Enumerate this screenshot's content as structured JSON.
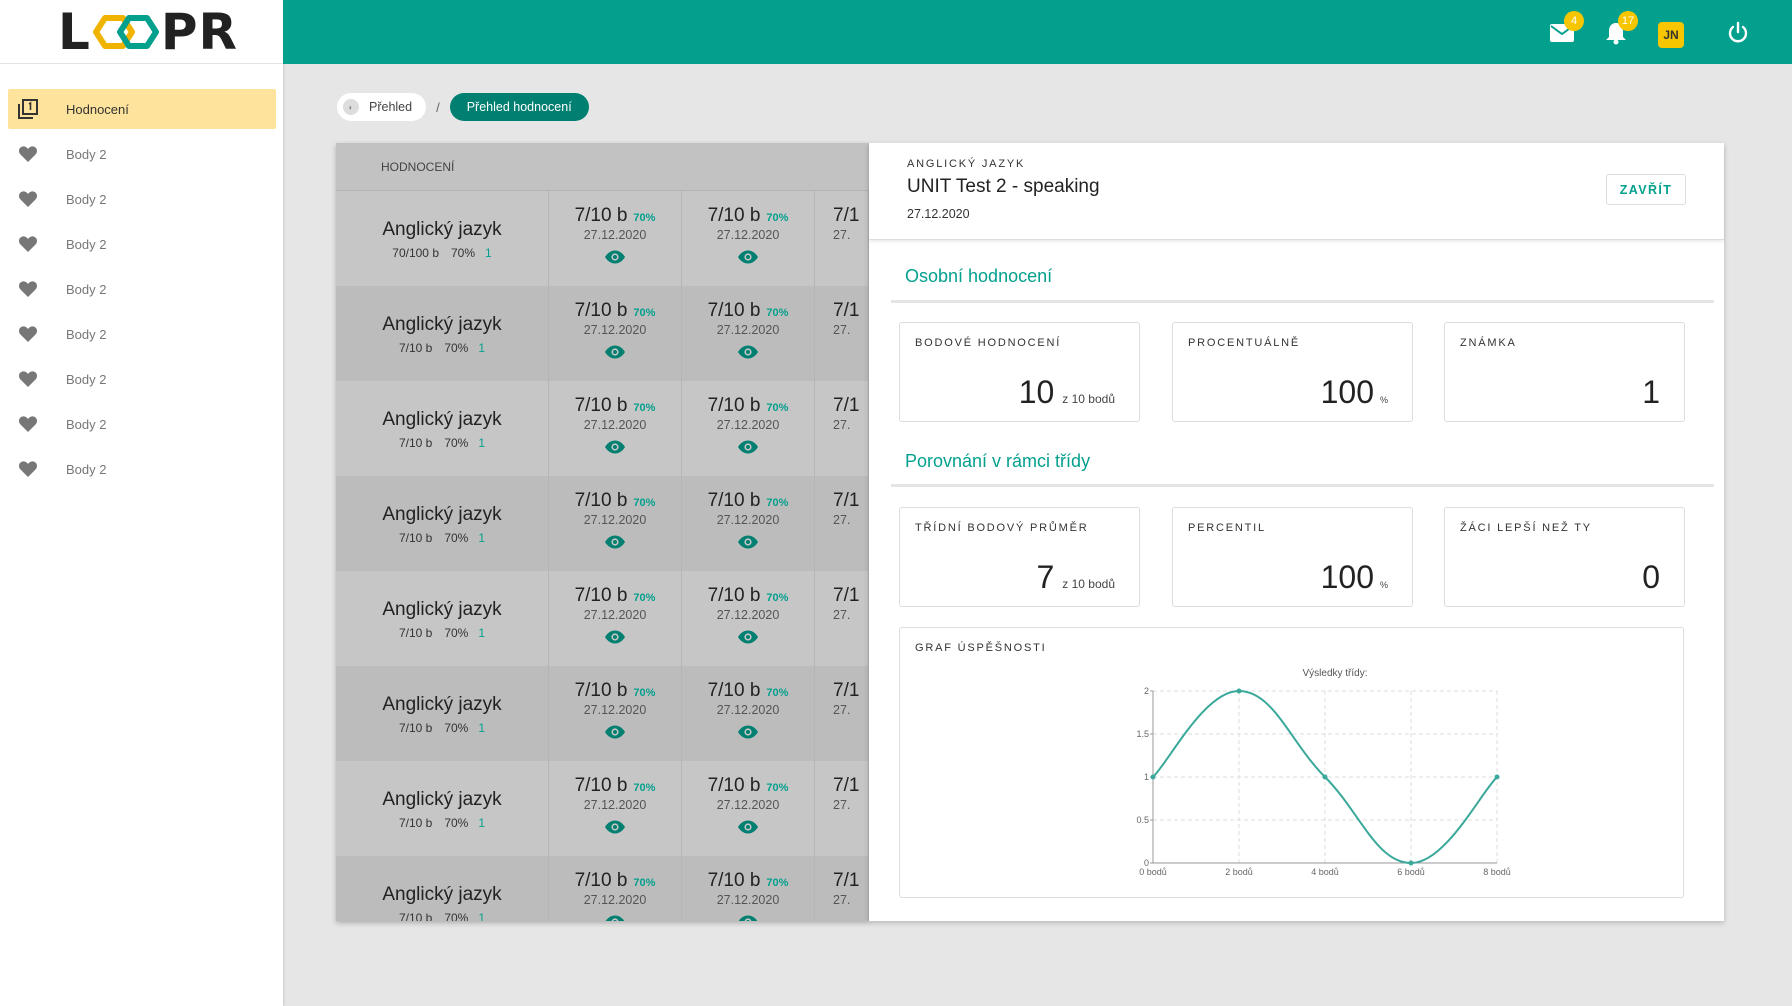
{
  "app": {
    "logo_left": "L",
    "logo_right": "PR"
  },
  "sidebar": {
    "items": [
      {
        "label": "Hodnocení",
        "icon": "library-icon",
        "active": true
      },
      {
        "label": "Body 2",
        "icon": "heart-icon"
      },
      {
        "label": "Body 2",
        "icon": "heart-icon"
      },
      {
        "label": "Body 2",
        "icon": "heart-icon"
      },
      {
        "label": "Body 2",
        "icon": "heart-icon"
      },
      {
        "label": "Body 2",
        "icon": "heart-icon"
      },
      {
        "label": "Body 2",
        "icon": "heart-icon"
      },
      {
        "label": "Body 2",
        "icon": "heart-icon"
      },
      {
        "label": "Body 2",
        "icon": "heart-icon"
      }
    ]
  },
  "topbar": {
    "mail_badge": "4",
    "notif_badge": "17",
    "avatar": "JN",
    "accent": "#04a08e",
    "badge_color": "#f7c600"
  },
  "breadcrumb": {
    "home": "Přehled",
    "separator": "/",
    "current": "Přehled hodnocení"
  },
  "grid": {
    "header": "HODNOCENÍ",
    "rows": [
      {
        "subject": "Anglický jazyk",
        "points": "70/100 b",
        "pct": "70%",
        "grade": "1",
        "cells": [
          {
            "value": "7/10 b",
            "pct": "70%",
            "date": "27.12.2020"
          },
          {
            "value": "7/10 b",
            "pct": "70%",
            "date": "27.12.2020"
          },
          {
            "value": "7/1",
            "pct": "",
            "date": "27."
          }
        ]
      },
      {
        "subject": "Anglický jazyk",
        "points": "7/10 b",
        "pct": "70%",
        "grade": "1",
        "cells": [
          {
            "value": "7/10 b",
            "pct": "70%",
            "date": "27.12.2020"
          },
          {
            "value": "7/10 b",
            "pct": "70%",
            "date": "27.12.2020"
          },
          {
            "value": "7/1",
            "pct": "",
            "date": "27."
          }
        ]
      },
      {
        "subject": "Anglický jazyk",
        "points": "7/10 b",
        "pct": "70%",
        "grade": "1",
        "cells": [
          {
            "value": "7/10 b",
            "pct": "70%",
            "date": "27.12.2020"
          },
          {
            "value": "7/10 b",
            "pct": "70%",
            "date": "27.12.2020"
          },
          {
            "value": "7/1",
            "pct": "",
            "date": "27."
          }
        ]
      },
      {
        "subject": "Anglický jazyk",
        "points": "7/10 b",
        "pct": "70%",
        "grade": "1",
        "cells": [
          {
            "value": "7/10 b",
            "pct": "70%",
            "date": "27.12.2020"
          },
          {
            "value": "7/10 b",
            "pct": "70%",
            "date": "27.12.2020"
          },
          {
            "value": "7/1",
            "pct": "",
            "date": "27."
          }
        ]
      },
      {
        "subject": "Anglický jazyk",
        "points": "7/10 b",
        "pct": "70%",
        "grade": "1",
        "cells": [
          {
            "value": "7/10 b",
            "pct": "70%",
            "date": "27.12.2020"
          },
          {
            "value": "7/10 b",
            "pct": "70%",
            "date": "27.12.2020"
          },
          {
            "value": "7/1",
            "pct": "",
            "date": "27."
          }
        ]
      },
      {
        "subject": "Anglický jazyk",
        "points": "7/10 b",
        "pct": "70%",
        "grade": "1",
        "cells": [
          {
            "value": "7/10 b",
            "pct": "70%",
            "date": "27.12.2020"
          },
          {
            "value": "7/10 b",
            "pct": "70%",
            "date": "27.12.2020"
          },
          {
            "value": "7/1",
            "pct": "",
            "date": "27."
          }
        ]
      },
      {
        "subject": "Anglický jazyk",
        "points": "7/10 b",
        "pct": "70%",
        "grade": "1",
        "cells": [
          {
            "value": "7/10 b",
            "pct": "70%",
            "date": "27.12.2020"
          },
          {
            "value": "7/10 b",
            "pct": "70%",
            "date": "27.12.2020"
          },
          {
            "value": "7/1",
            "pct": "",
            "date": "27."
          }
        ]
      },
      {
        "subject": "Anglický jazyk",
        "points": "7/10 b",
        "pct": "70%",
        "grade": "1",
        "cells": [
          {
            "value": "7/10 b",
            "pct": "70%",
            "date": "27.12.2020"
          },
          {
            "value": "7/10 b",
            "pct": "70%",
            "date": "27.12.2020"
          },
          {
            "value": "7/1",
            "pct": "",
            "date": "27."
          }
        ]
      }
    ]
  },
  "detail": {
    "subject": "ANGLICKÝ JAZYK",
    "title": "UNIT Test 2 - speaking",
    "date": "27.12.2020",
    "close": "ZAVŘÍT",
    "personal": {
      "heading": "Osobní hodnocení",
      "points_label": "BODOVÉ HODNOCENÍ",
      "points_value": "10",
      "points_unit": "z 10 bodů",
      "percent_label": "PROCENTUÁLNĚ",
      "percent_value": "100",
      "percent_unit": "%",
      "grade_label": "ZNÁMKA",
      "grade_value": "1"
    },
    "comparison": {
      "heading": "Porovnání v rámci třídy",
      "avg_label": "TŘÍDNÍ BODOVÝ PRŮMĚR",
      "avg_value": "7",
      "avg_unit": "z 10 bodů",
      "percentile_label": "PERCENTIL",
      "percentile_value": "100",
      "percentile_unit": "%",
      "better_label": "ŽÁCI LEPŠÍ NEŽ TY",
      "better_value": "0"
    },
    "graph_label": "GRAF ÚSPĚŠNOSTI"
  },
  "chart_data": {
    "type": "line",
    "title": "Výsledky třídy:",
    "categories": [
      "0 bodů",
      "2 bodů",
      "4 bodů",
      "6 bodů",
      "8 bodů"
    ],
    "values": [
      1,
      2,
      1,
      0,
      1
    ],
    "yticks": [
      "0",
      "0.5",
      "1",
      "1.5",
      "2"
    ],
    "ylim": [
      0,
      2
    ],
    "grid": true,
    "color": "#3aa99b"
  }
}
